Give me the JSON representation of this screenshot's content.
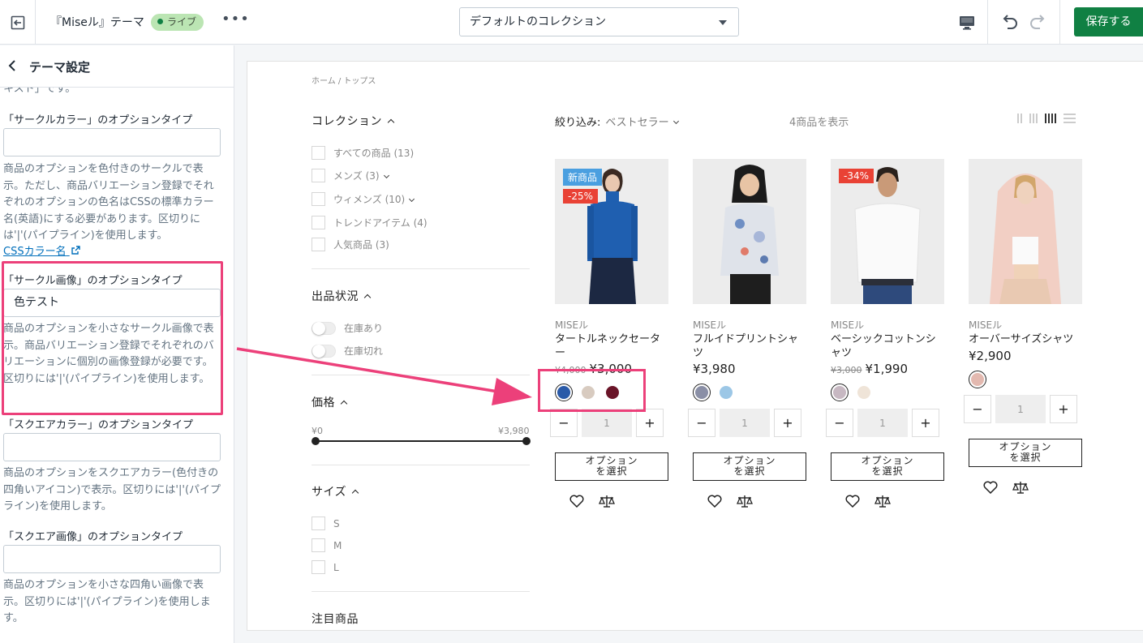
{
  "topbar": {
    "theme_name": "『Miseル』テーマ",
    "live_label": "ライブ",
    "more_label": "•••",
    "collection_select": "デフォルトのコレクション",
    "save_label": "保存する"
  },
  "sidebar": {
    "title": "テーマ設定",
    "top_cut_text": "キスト」です。",
    "circle_color": {
      "label": "「サークルカラー」のオプションタイプ",
      "value": "",
      "help": "商品のオプションを色付きのサークルで表示。ただし、商品バリエーション登録でそれぞれのオプションの色名はCSSの標準カラー名(英語)にする必要があります。区切りには'|'(パイプライン)を使用します。",
      "link": "CSSカラー名"
    },
    "circle_image": {
      "label": "「サークル画像」のオプションタイプ",
      "value": "色テスト",
      "help": "商品のオプションを小さなサークル画像で表示。商品バリエーション登録でそれぞれのバリエーションに個別の画像登録が必要です。区切りには'|'(パイプライン)を使用します。"
    },
    "square_color": {
      "label": "「スクエアカラー」のオプションタイプ",
      "value": "",
      "help": "商品のオプションをスクエアカラー(色付きの四角いアイコン)で表示。区切りには'|'(パイプライン)を使用します。"
    },
    "square_image": {
      "label": "「スクエア画像」のオプションタイプ",
      "value": "",
      "help": "商品のオプションを小さな四角い画像で表示。区切りには'|'(パイプライン)を使用します。"
    }
  },
  "preview": {
    "breadcrumb": "ホーム / トップス",
    "filters": {
      "collection_title": "コレクション",
      "collections": [
        "すべての商品 (13)",
        "メンズ (3)",
        "ウィメンズ (10)",
        "トレンドアイテム (4)",
        "人気商品 (3)"
      ],
      "stock_title": "出品状況",
      "stock": [
        "在庫あり",
        "在庫切れ"
      ],
      "price_title": "価格",
      "price_min": "¥0",
      "price_max": "¥3,980",
      "size_title": "サイズ",
      "sizes": [
        "S",
        "M",
        "L"
      ],
      "featured_title": "注目商品"
    },
    "sort_label": "絞り込み:",
    "sort_value": "ベストセラー",
    "count_label": "4商品を表示",
    "qty_value": "1",
    "minus": "−",
    "plus": "+",
    "option_button": [
      "オプション",
      "を選択"
    ],
    "products": [
      {
        "vendor": "MISEル",
        "title": "タートルネックセーター",
        "old_price": "¥4,000",
        "price": "¥3,000",
        "badge_new": "新商品",
        "badge_off": "-25%",
        "swatches": [
          "#2a5aa8",
          "#d8cbc0",
          "#6a1428"
        ]
      },
      {
        "vendor": "MISEル",
        "title": "フルイドプリントシャツ",
        "old_price": "",
        "price": "¥3,980",
        "badge_new": "",
        "badge_off": "",
        "swatches": [
          "#8a8fa6",
          "#9cc7e6"
        ]
      },
      {
        "vendor": "MISEル",
        "title": "ベーシックコットンシャツ",
        "old_price": "¥3,000",
        "price": "¥1,990",
        "badge_new": "",
        "badge_off": "-34%",
        "swatches": [
          "#c7b8c2",
          "#efe4d8"
        ]
      },
      {
        "vendor": "MISEル",
        "title": "オーバーサイズシャツ",
        "old_price": "",
        "price": "¥2,900",
        "badge_new": "",
        "badge_off": "",
        "swatches": [
          "#e3b9b0"
        ]
      }
    ]
  },
  "colors": {
    "save_green": "#108043",
    "live_badge": "#bbe5b3",
    "highlight_pink": "#ec407a",
    "badge_new": "#4a9fe0",
    "badge_sale": "#e94235"
  }
}
